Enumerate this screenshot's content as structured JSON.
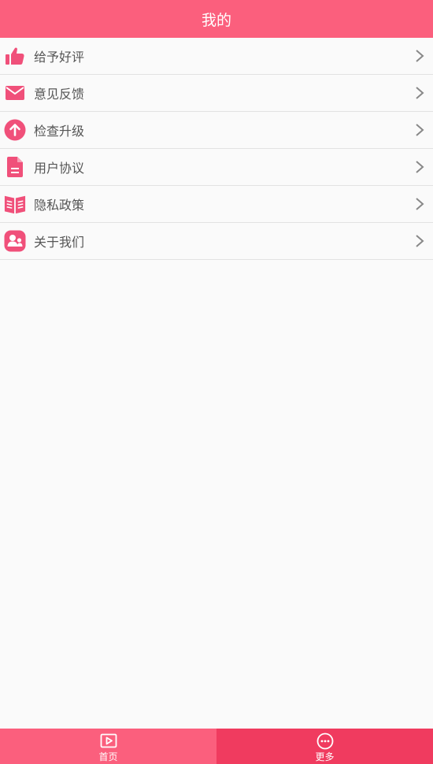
{
  "header": {
    "title": "我的"
  },
  "menu": {
    "items": [
      {
        "label": "给予好评",
        "icon": "thumbs-up-icon"
      },
      {
        "label": "意见反馈",
        "icon": "mail-icon"
      },
      {
        "label": "检查升级",
        "icon": "upgrade-arrow-icon"
      },
      {
        "label": "用户协议",
        "icon": "document-icon"
      },
      {
        "label": "隐私政策",
        "icon": "book-icon"
      },
      {
        "label": "关于我们",
        "icon": "users-icon"
      }
    ]
  },
  "tabbar": {
    "tabs": [
      {
        "label": "首页",
        "icon": "play-square-icon"
      },
      {
        "label": "更多",
        "icon": "more-circle-icon"
      }
    ]
  },
  "colors": {
    "accent": "#fb5f7d",
    "accent_active": "#f03b5f",
    "icon": "#f0507a",
    "text": "#555555",
    "chevron": "#888888",
    "background": "#fafafa"
  }
}
